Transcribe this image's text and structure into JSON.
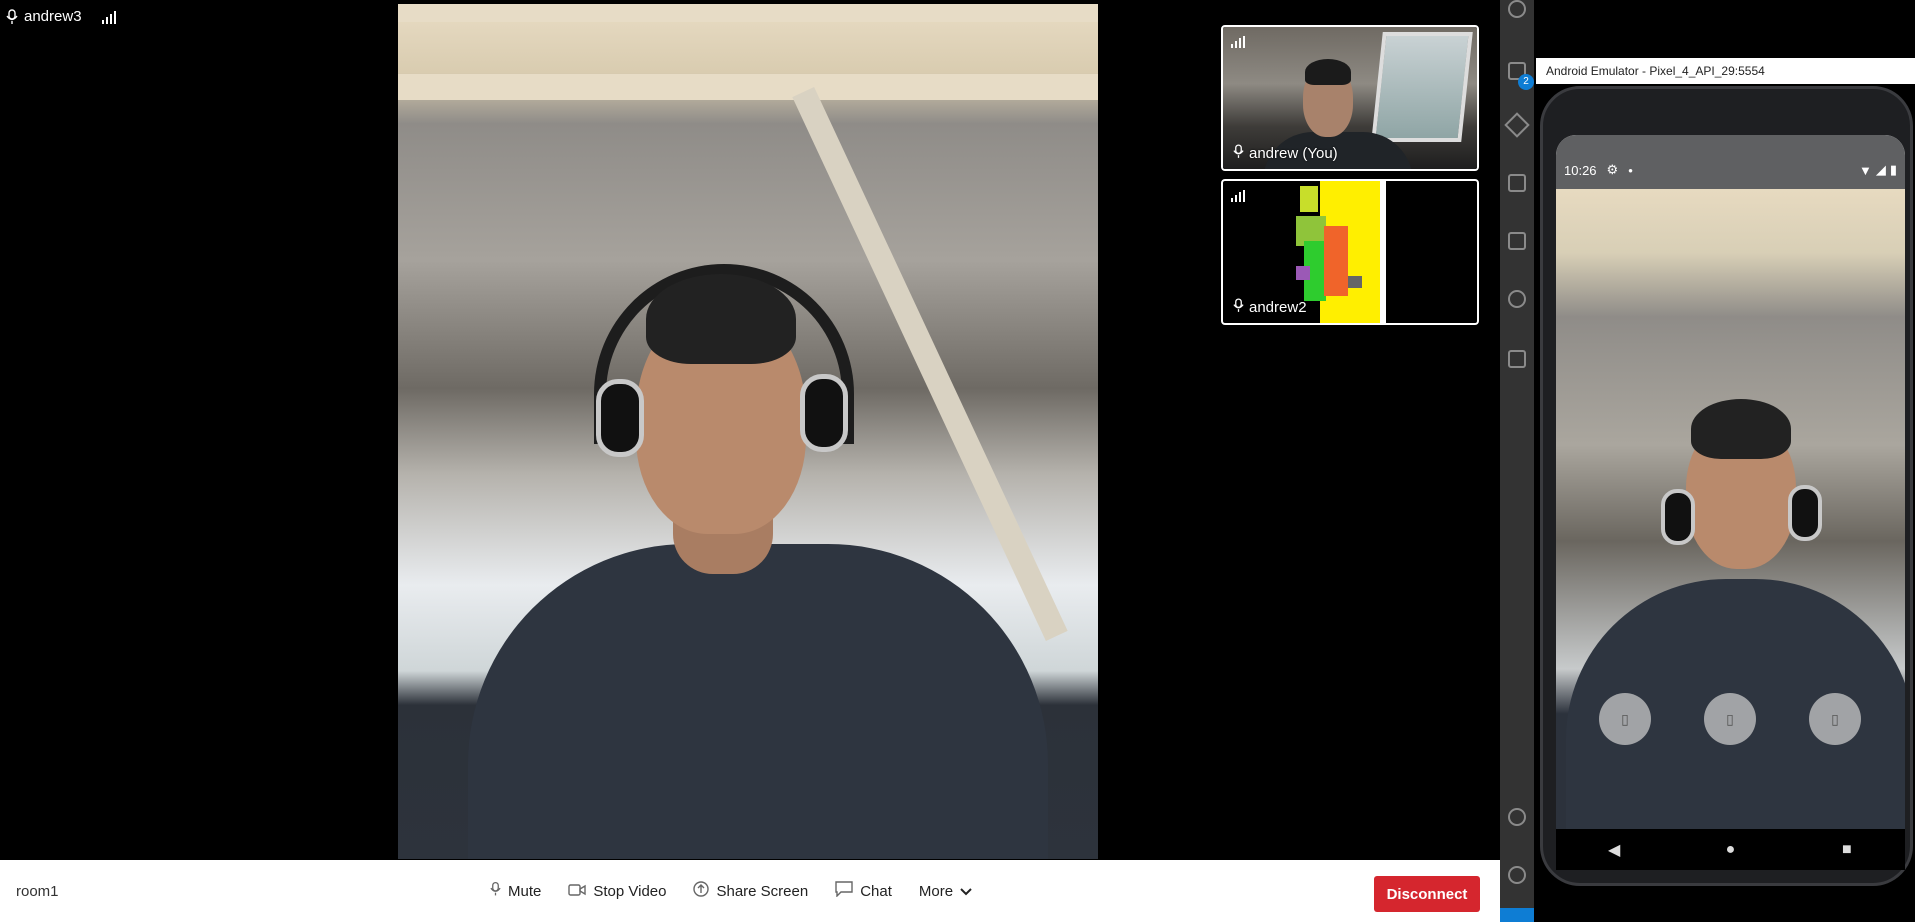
{
  "main": {
    "participant_name": "andrew3"
  },
  "tiles": [
    {
      "name": "andrew (You)"
    },
    {
      "name": "andrew2"
    }
  ],
  "toolbar": {
    "room_name": "room1",
    "mute_label": "Mute",
    "stop_video_label": "Stop Video",
    "share_screen_label": "Share Screen",
    "chat_label": "Chat",
    "more_label": "More",
    "disconnect_label": "Disconnect"
  },
  "ide": {
    "badge_count": "2"
  },
  "emulator": {
    "window_title": "Android Emulator - Pixel_4_API_29:5554",
    "status_time": "10:26",
    "fab_labels": [
      "▯",
      "▯",
      "▯"
    ],
    "nav": {
      "back": "◀",
      "home": "●",
      "recents": "■"
    }
  },
  "colors": {
    "disconnect_bg": "#d5262e",
    "ide_accent": "#0e7dd4",
    "toolbar_bg": "#ffffff"
  }
}
